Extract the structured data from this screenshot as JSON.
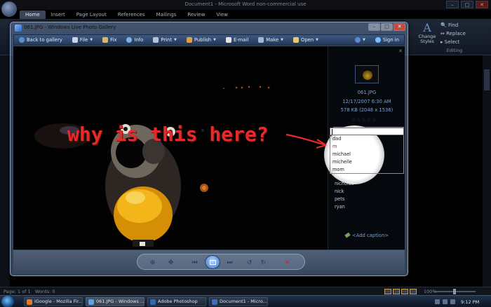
{
  "word": {
    "title": "Document1 - Microsoft Word non-commercial use",
    "tabs": [
      "Home",
      "Insert",
      "Page Layout",
      "References",
      "Mailings",
      "Review",
      "View"
    ],
    "active_tab": "Home",
    "change_styles_label": "Change Styles",
    "find_label": "Find",
    "replace_label": "Replace",
    "select_label": "Select",
    "editing_group_label": "Editing",
    "status_page": "Page: 1 of 1",
    "status_words": "Words: 0",
    "zoom_level": "100%"
  },
  "gallery": {
    "window_title": "061.JPG - Windows Live Photo Gallery",
    "toolbar": {
      "back": "Back to gallery",
      "file": "File",
      "fix": "Fix",
      "info": "Info",
      "print": "Print",
      "publish": "Publish",
      "email": "E-mail",
      "make": "Make",
      "open": "Open",
      "sign_in": "Sign in"
    },
    "info_pane": {
      "filename": "061.JPG",
      "datetime": "12/17/2007   6:30 AM",
      "filesize": "578 KB (2048 x 1536)",
      "add_caption": "<Add caption>",
      "tags": [
        "dad",
        "m",
        "michael",
        "michelle",
        "mom",
        "nataine",
        "nicholas",
        "nick",
        "pets",
        "ryan"
      ]
    }
  },
  "annotation": {
    "text": "why is this here?",
    "color": "#e32b2b"
  },
  "taskbar": {
    "items": [
      "iGoogle - Mozilla Fir...",
      "061.JPG - Windows ...",
      "Adobe Photoshop",
      "Document1 - Micro..."
    ],
    "active_index": 1,
    "clock": "9:12 PM"
  },
  "colors": {
    "accent": "#3e5a82",
    "tag_highlight": "#c62020"
  }
}
